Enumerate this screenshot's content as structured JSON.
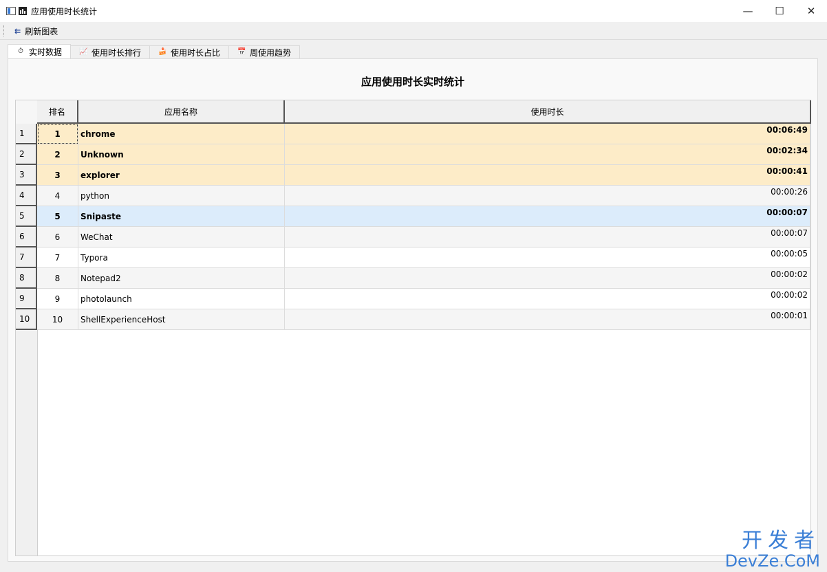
{
  "window": {
    "title": "应用使用时长统计",
    "controls": {
      "minimize": "—",
      "maximize": "☐",
      "close": "✕"
    }
  },
  "toolbar": {
    "refresh_label": "刷新图表",
    "refresh_icon": "⇇"
  },
  "tabs": [
    {
      "label": "实时数据",
      "icon": "⏱"
    },
    {
      "label": "使用时长排行",
      "icon": "📈"
    },
    {
      "label": "使用时长占比",
      "icon": "🍰"
    },
    {
      "label": "周使用趋势",
      "icon": "📅"
    }
  ],
  "main": {
    "heading": "应用使用时长实时统计",
    "columns": [
      "排名",
      "应用名称",
      "使用时长"
    ],
    "rows": [
      {
        "num": "1",
        "rank": "1",
        "name": "chrome",
        "time": "00:06:49"
      },
      {
        "num": "2",
        "rank": "2",
        "name": "Unknown",
        "time": "00:02:34"
      },
      {
        "num": "3",
        "rank": "3",
        "name": "explorer",
        "time": "00:00:41"
      },
      {
        "num": "4",
        "rank": "4",
        "name": "python",
        "time": "00:00:26"
      },
      {
        "num": "5",
        "rank": "5",
        "name": "Snipaste",
        "time": "00:00:07"
      },
      {
        "num": "6",
        "rank": "6",
        "name": "WeChat",
        "time": "00:00:07"
      },
      {
        "num": "7",
        "rank": "7",
        "name": "Typora",
        "time": "00:00:05"
      },
      {
        "num": "8",
        "rank": "8",
        "name": "Notepad2",
        "time": "00:00:02"
      },
      {
        "num": "9",
        "rank": "9",
        "name": "photolaunch",
        "time": "00:00:02"
      },
      {
        "num": "10",
        "rank": "10",
        "name": "ShellExperienceHost",
        "time": "00:00:01"
      }
    ]
  },
  "watermark": {
    "line1": "开发者",
    "line2": "DevZe.CoM"
  }
}
